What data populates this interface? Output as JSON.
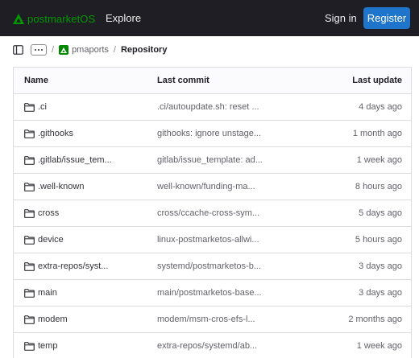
{
  "header": {
    "brand": "postmarketOS",
    "explore": "Explore",
    "sign_in": "Sign in",
    "register": "Register",
    "brand_color": "#009900",
    "bg_color": "#1f1e24",
    "accent": "#1f75cb"
  },
  "breadcrumb": {
    "sep": "/",
    "project": "pmaports",
    "current": "Repository"
  },
  "table": {
    "columns": {
      "name": "Name",
      "commit": "Last commit",
      "update": "Last update"
    },
    "rows": [
      {
        "name": ".ci",
        "commit": ".ci/autoupdate.sh: reset ...",
        "update": "4 days ago"
      },
      {
        "name": ".githooks",
        "commit": "githooks: ignore unstage...",
        "update": "1 month ago"
      },
      {
        "name": ".gitlab/issue_tem...",
        "commit": "gitlab/issue_template: ad...",
        "update": "1 week ago"
      },
      {
        "name": ".well-known",
        "commit": "well-known/funding-ma...",
        "update": "8 hours ago"
      },
      {
        "name": "cross",
        "commit": "cross/ccache-cross-sym...",
        "update": "5 days ago"
      },
      {
        "name": "device",
        "commit": "linux-postmarketos-allwi...",
        "update": "5 hours ago"
      },
      {
        "name": "extra-repos/syst...",
        "commit": "systemd/postmarketos-b...",
        "update": "3 days ago"
      },
      {
        "name": "main",
        "commit": "main/postmarketos-base...",
        "update": "3 days ago"
      },
      {
        "name": "modem",
        "commit": "modem/msm-cros-efs-l...",
        "update": "2 months ago"
      },
      {
        "name": "temp",
        "commit": "extra-repos/systemd/ab...",
        "update": "1 week ago"
      }
    ]
  }
}
